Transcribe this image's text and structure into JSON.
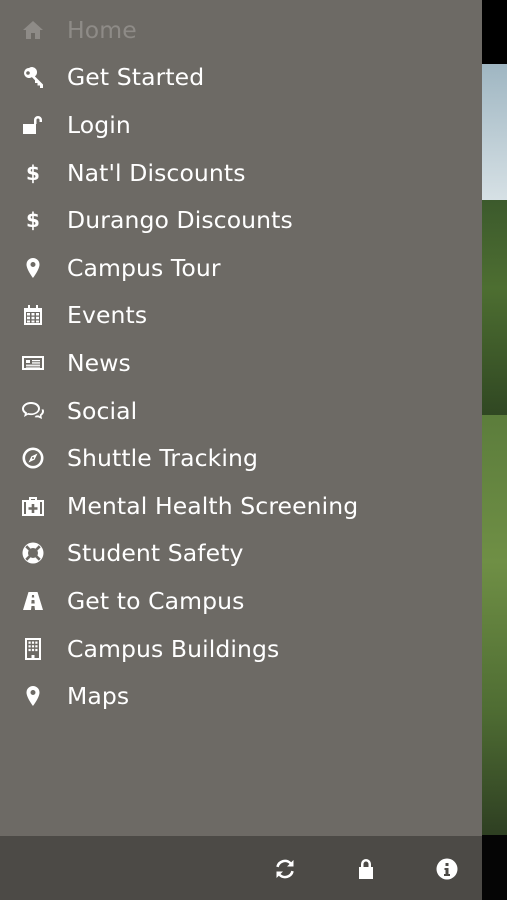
{
  "menu": {
    "items": [
      {
        "label": "Home",
        "icon": "home-icon",
        "state": "current"
      },
      {
        "label": "Get Started",
        "icon": "key-icon"
      },
      {
        "label": "Login",
        "icon": "unlock-icon"
      },
      {
        "label": "Nat'l Discounts",
        "icon": "dollar-icon"
      },
      {
        "label": "Durango Discounts",
        "icon": "dollar-icon"
      },
      {
        "label": "Campus Tour",
        "icon": "map-marker-icon"
      },
      {
        "label": "Events",
        "icon": "calendar-icon"
      },
      {
        "label": "News",
        "icon": "newspaper-icon"
      },
      {
        "label": "Social",
        "icon": "chat-bubbles-icon"
      },
      {
        "label": "Shuttle Tracking",
        "icon": "compass-icon"
      },
      {
        "label": "Mental Health Screening",
        "icon": "medkit-icon"
      },
      {
        "label": "Student Safety",
        "icon": "life-ring-icon"
      },
      {
        "label": "Get to Campus",
        "icon": "road-icon"
      },
      {
        "label": "Campus Buildings",
        "icon": "building-icon"
      },
      {
        "label": "Maps",
        "icon": "map-marker-icon"
      }
    ]
  },
  "footer": {
    "icons": [
      "refresh-icon",
      "lock-icon",
      "info-icon"
    ]
  },
  "colors": {
    "drawer_bg": "#6d6a65",
    "footer_bg": "#4c4a46",
    "text": "#ffffff",
    "text_dim": "#8e8b87"
  }
}
